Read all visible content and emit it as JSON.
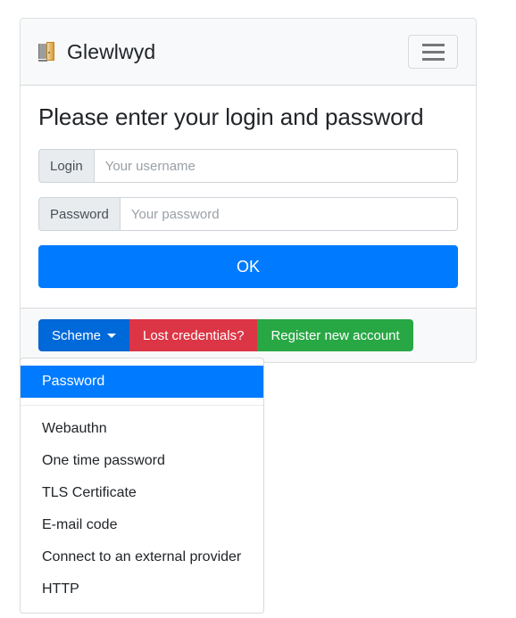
{
  "app": {
    "brand_name": "Glewlwyd",
    "brand_icon": "door-icon",
    "toggler_icon": "hamburger-menu-icon"
  },
  "login_form": {
    "title": "Please enter your login and password",
    "login": {
      "label": "Login",
      "placeholder": "Your username",
      "value": ""
    },
    "password": {
      "label": "Password",
      "placeholder": "Your password",
      "value": ""
    },
    "submit_label": "OK"
  },
  "footer": {
    "scheme_button": {
      "label": "Scheme",
      "caret_icon": "caret-down-icon"
    },
    "lost_credentials_label": "Lost credentials?",
    "register_label": "Register new account"
  },
  "scheme_dropdown": {
    "expanded": true,
    "items": [
      {
        "label": "Password",
        "active": true
      },
      {
        "label": "Webauthn",
        "active": false
      },
      {
        "label": "One time password",
        "active": false
      },
      {
        "label": "TLS Certificate",
        "active": false
      },
      {
        "label": "E-mail code",
        "active": false
      },
      {
        "label": "Connect to an external provider",
        "active": false
      },
      {
        "label": "HTTP",
        "active": false
      }
    ]
  },
  "colors": {
    "primary": "#007bff",
    "primary_active": "#0069d9",
    "danger": "#dc3545",
    "success": "#28a745",
    "surface": "#f8f9fa",
    "border": "#ced4da"
  }
}
